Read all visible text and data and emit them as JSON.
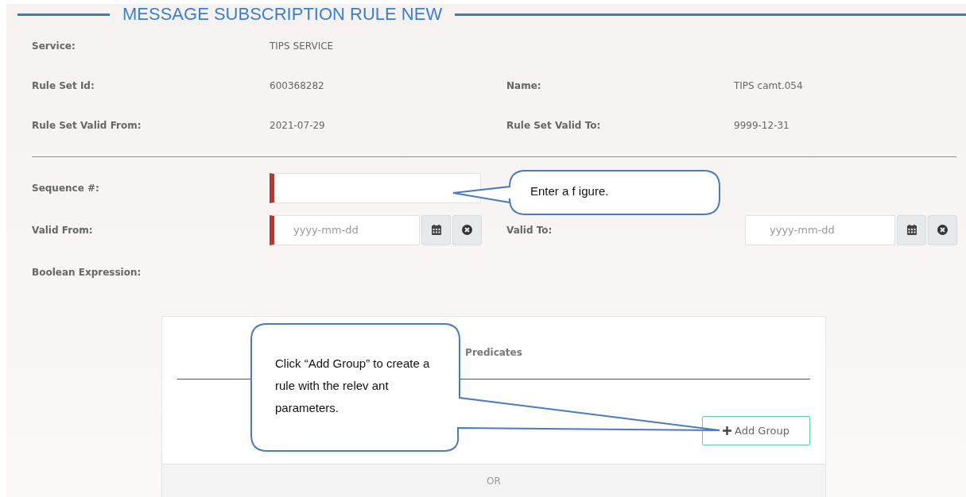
{
  "title": "MESSAGE SUBSCRIPTION RULE NEW",
  "info_rows": [
    [
      {
        "label": "Service:",
        "value": "TIPS SERVICE"
      }
    ],
    [
      {
        "label": "Rule Set Id:",
        "value": "600368282"
      },
      {
        "label": "Name:",
        "value": "TIPS camt.054"
      }
    ],
    [
      {
        "label": "Rule Set Valid From:",
        "value": "2021-07-29"
      },
      {
        "label": "Rule Set Valid To:",
        "value": "9999-12-31"
      }
    ]
  ],
  "form": {
    "sequence": {
      "label": "Sequence #:",
      "required": true
    },
    "valid_from": {
      "label": "Valid From:",
      "placeholder": "yyyy-mm-dd",
      "required": true
    },
    "valid_to": {
      "label": "Valid To:",
      "placeholder": "yyyy-mm-dd",
      "required": false
    },
    "boolean_label": "Boolean Expression:"
  },
  "predicates": {
    "title": "Predicates",
    "add_button": "Add Group",
    "or_label": "OR"
  },
  "callouts": [
    {
      "text": "Enter a f igure."
    },
    {
      "text": "Click “Add Group” to create a rule with the relev ant parameters."
    }
  ]
}
